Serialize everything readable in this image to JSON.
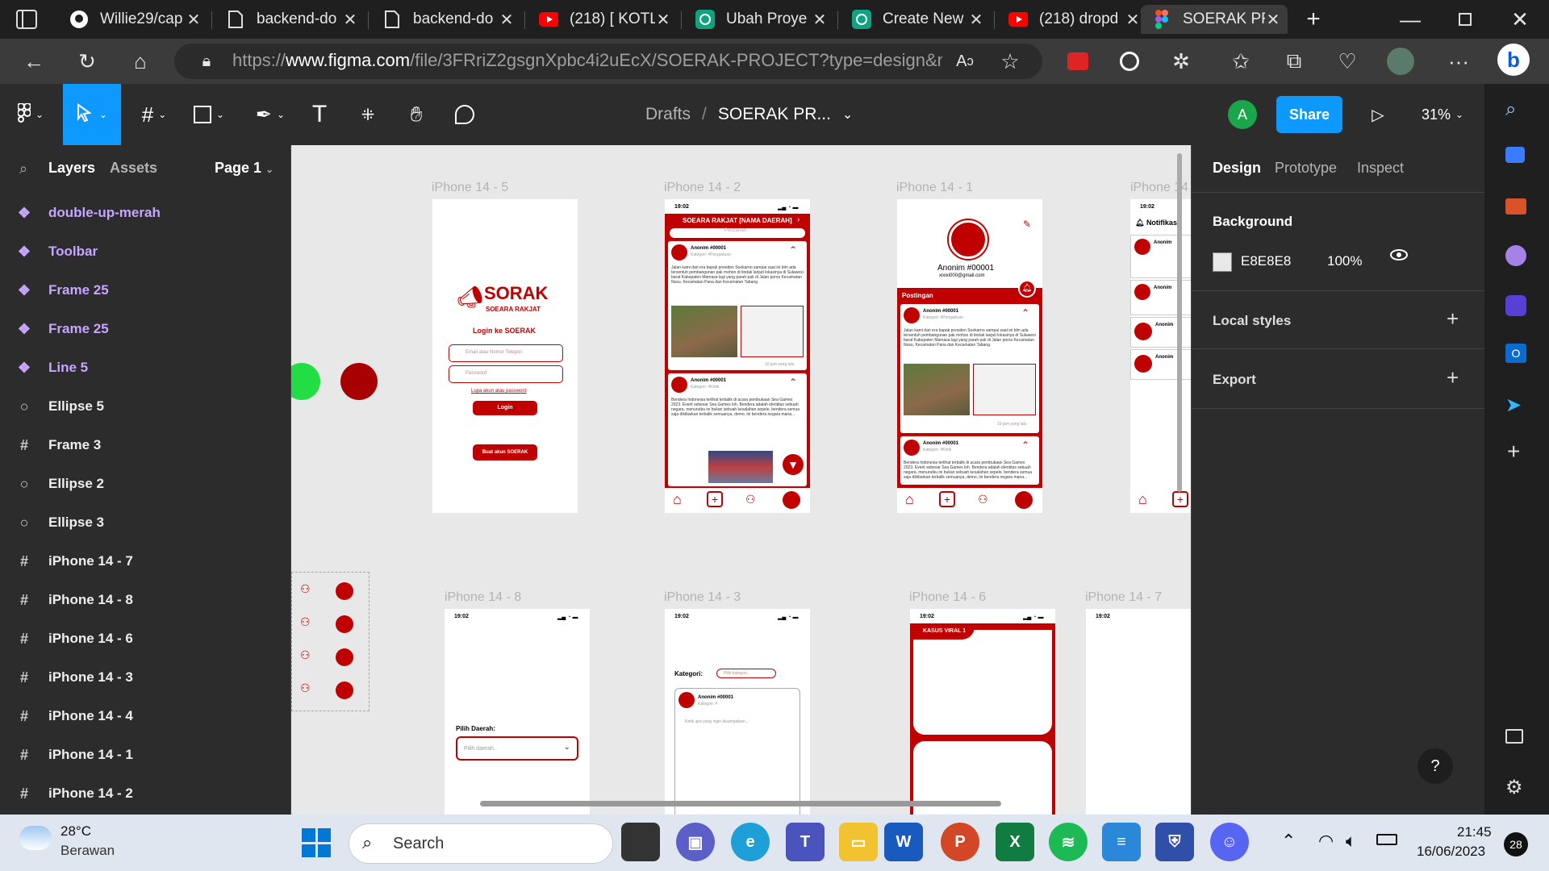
{
  "browser": {
    "tabs": [
      {
        "title": "Willie29/cap",
        "icon": "github-icon"
      },
      {
        "title": "backend-do",
        "icon": "page-icon"
      },
      {
        "title": "backend-do",
        "icon": "page-icon"
      },
      {
        "title": "(218) [ KOTL",
        "icon": "youtube-icon"
      },
      {
        "title": "Ubah Proye",
        "icon": "chatgpt-icon"
      },
      {
        "title": "Create New",
        "icon": "chatgpt-icon"
      },
      {
        "title": "(218) dropd",
        "icon": "youtube-icon"
      },
      {
        "title": "SOERAK PR",
        "icon": "figma-icon",
        "active": true
      }
    ],
    "url_prefix": "https://",
    "url_host": "www.figma.com",
    "url_path": "/file/3FRriZ2gsgnXpbc4i2uEcX/SOERAK-PROJECT?type=design&nod..."
  },
  "figma": {
    "breadcrumb_drafts": "Drafts",
    "breadcrumb_sep": "/",
    "file_name": "SOERAK PR...",
    "avatar_letter": "A",
    "share_label": "Share",
    "zoom": "31%",
    "accent": "#0d99ff"
  },
  "layers_panel": {
    "tab_layers": "Layers",
    "tab_assets": "Assets",
    "page": "Page 1",
    "items": [
      {
        "name": "double-up-merah",
        "kind": "component"
      },
      {
        "name": "Toolbar",
        "kind": "component"
      },
      {
        "name": "Frame 25",
        "kind": "component"
      },
      {
        "name": "Frame 25",
        "kind": "component"
      },
      {
        "name": "Line 5",
        "kind": "component"
      },
      {
        "name": "Ellipse 5",
        "kind": "ellipse"
      },
      {
        "name": "Frame 3",
        "kind": "frame"
      },
      {
        "name": "Ellipse 2",
        "kind": "ellipse"
      },
      {
        "name": "Ellipse 3",
        "kind": "ellipse"
      },
      {
        "name": "iPhone 14 - 7",
        "kind": "frame"
      },
      {
        "name": "iPhone 14 - 8",
        "kind": "frame"
      },
      {
        "name": "iPhone 14 - 6",
        "kind": "frame"
      },
      {
        "name": "iPhone 14 - 3",
        "kind": "frame"
      },
      {
        "name": "iPhone 14 - 4",
        "kind": "frame"
      },
      {
        "name": "iPhone 14 - 1",
        "kind": "frame"
      },
      {
        "name": "iPhone 14 - 2",
        "kind": "frame"
      }
    ]
  },
  "canvas": {
    "frames": {
      "f5": "iPhone 14 - 5",
      "f2": "iPhone 14 - 2",
      "f1": "iPhone 14 - 1",
      "f4": "iPhone 14",
      "f8": "iPhone 14 - 8",
      "f3": "iPhone 14 - 3",
      "f6": "iPhone 14 - 6",
      "f7": "iPhone 14 - 7"
    },
    "time": "19:02",
    "login": {
      "brand": "SORAK",
      "brand_sub": "SOEARA RAKJAT",
      "heading": "Login ke SOERAK",
      "email_ph": "Email atau Nomor Telepon",
      "password_ph": "Password",
      "forgot": "Lupa akun atau password",
      "login_btn": "Login",
      "create_btn": "Buat akun SOERAK"
    },
    "feed": {
      "header": "SOEARA RAKJAT [NAMA DAERAH]",
      "search_ph": "Pencarian...",
      "post1_user": "Anonim #00001",
      "post1_cat": "Kategori: #Pengaduan",
      "post1_body": "Jalan kami dari era bapak presiden Soekarno sampai saat ini blm ada tersentuh pembangunan pak mohon di tindak lanjuti lokasinya di Sulawesi barat Kabupaten Mamasa lagi yang parah pak di Jalan poros Kecamatan Nosu, Kecamatan Pana dan Kecamatan Tabang.",
      "post1_time": "10 jam yang lalu",
      "post2_user": "Anonim #00001",
      "post2_cat": "Kategori: #Kritik",
      "post2_body": "Bendera Indonesia terlihat terbalik di acara pembukaan Sea Games 2023. Event sebesar Sea Games loh. Bendera adalah identitas sebuah negara, menurutku ini bukan sebuah kesalahan sepele, bendera semua saja dikibarkan terbalik semuanya, demo, ini bendera negara mana..."
    },
    "profile": {
      "user": "Anonim #00001",
      "email": "xixixi000@gmail.com",
      "posts_label": "Postingan"
    },
    "notif": {
      "title": "Notifikas",
      "user": "Anonim"
    },
    "region": {
      "label": "Pilih Daerah:",
      "ph": "Pilih daerah.."
    },
    "category": {
      "label": "Kategori:",
      "ph": "Pilih kategori...",
      "user": "Anonim #00001",
      "cat": "Kategori: #",
      "ph2": "Ketik apa yang ingin disampaikan..."
    },
    "viral": {
      "label": "KASUS VIRAL 1"
    }
  },
  "design_panel": {
    "tabs": [
      "Design",
      "Prototype",
      "Inspect"
    ],
    "background_label": "Background",
    "bg_hex": "E8E8E8",
    "bg_opacity": "100%",
    "local_styles": "Local styles",
    "export": "Export"
  },
  "taskbar": {
    "weather_temp": "28°C",
    "weather_desc": "Berawan",
    "search_placeholder": "Search",
    "time": "21:45",
    "date": "16/06/2023",
    "badge": "28"
  }
}
